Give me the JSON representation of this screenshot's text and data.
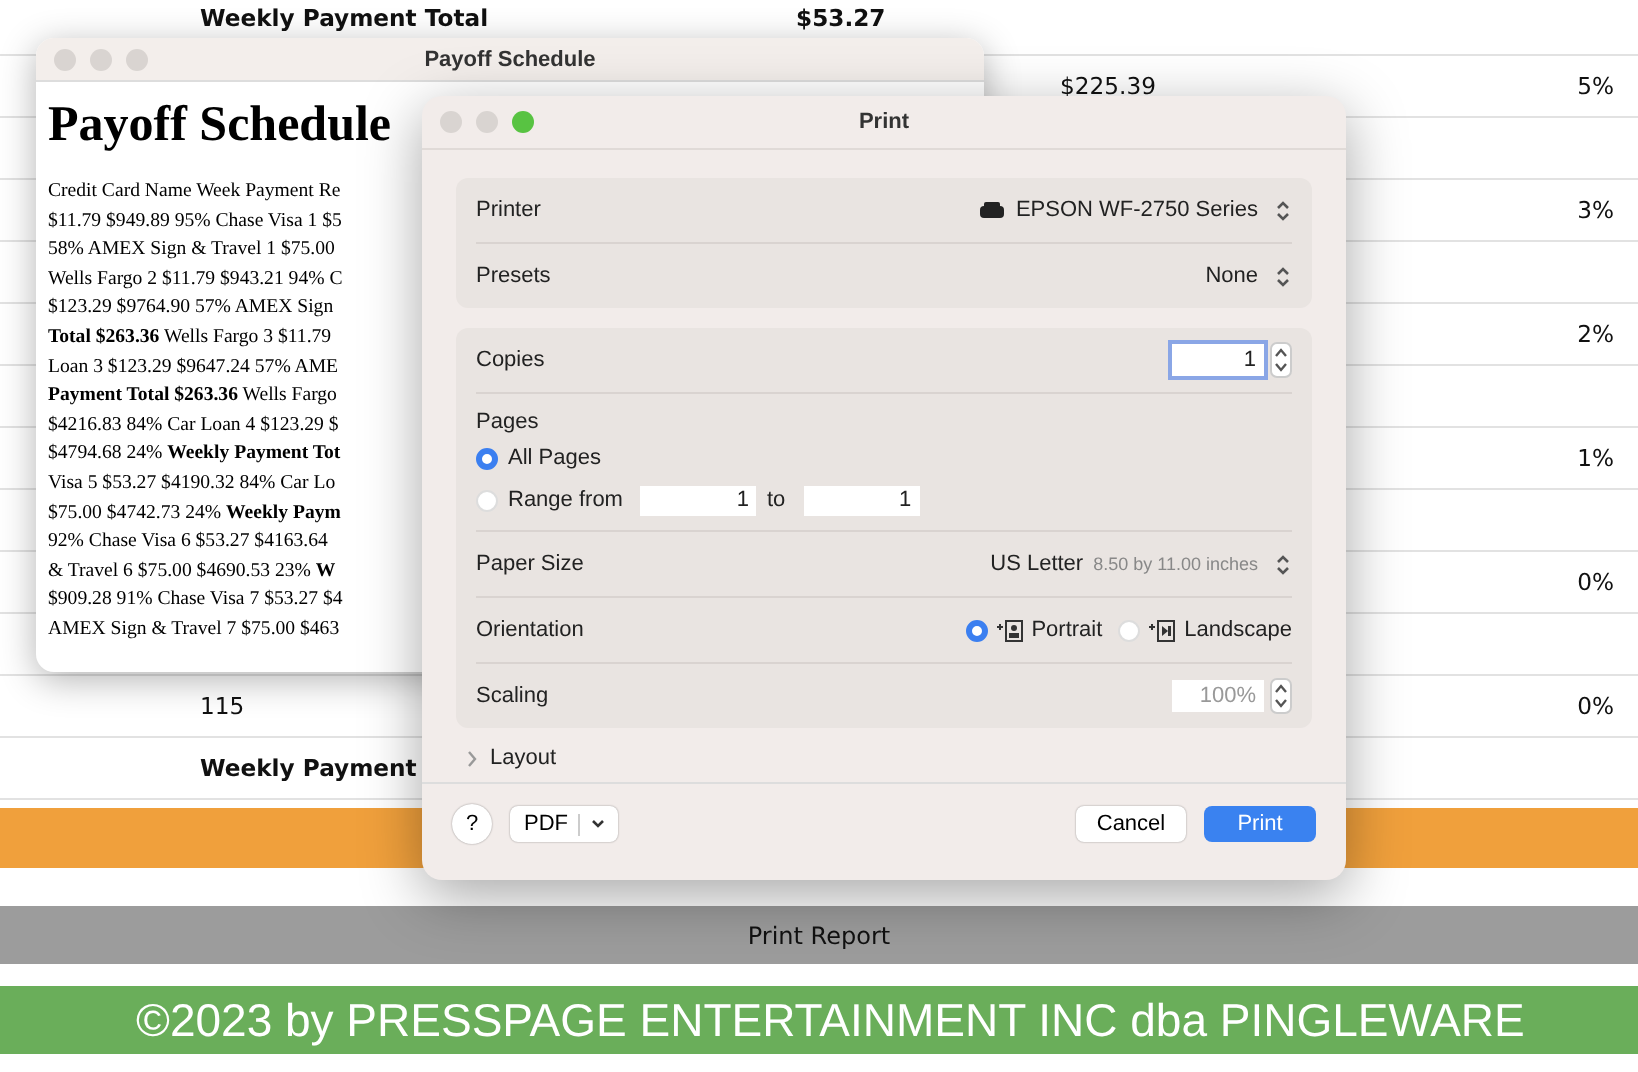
{
  "report": {
    "rows": [
      {
        "kind": "total",
        "col_1": "Weekly Payment Total",
        "col_2": "$53.27"
      },
      {
        "kind": "data",
        "col_3": "$225.39",
        "col_4": "5%"
      },
      {
        "kind": "blank"
      },
      {
        "kind": "data",
        "col_4": "3%"
      },
      {
        "kind": "blank"
      },
      {
        "kind": "data",
        "col_4": "2%"
      },
      {
        "kind": "blank"
      },
      {
        "kind": "data",
        "col_4": "1%"
      },
      {
        "kind": "blank"
      },
      {
        "kind": "data",
        "col_4": "0%"
      },
      {
        "kind": "blank"
      },
      {
        "kind": "data",
        "col_1": "115",
        "col_4": "0%"
      },
      {
        "kind": "total",
        "col_1": "Weekly Payment"
      }
    ],
    "print_button": "Print Report",
    "footer": "©2023 by PRESSPAGE ENTERTAINMENT INC dba PINGLEWARE"
  },
  "payoff_window": {
    "title": "Payoff Schedule",
    "heading": "Payoff Schedule",
    "lines": [
      "Credit Card Name Week Payment Re",
      "$11.79 $949.89 95% Chase Visa 1 $5",
      "58% AMEX Sign & Travel 1 $75.00",
      "Wells Fargo 2 $11.79 $943.21 94% C",
      "$123.29 $9764.90 57% AMEX Sign",
      "**Total $263.36** Wells Fargo 3 $11.79",
      "Loan 3 $123.29 $9647.24 57% AME",
      "**Payment Total $263.36** Wells Fargo",
      "$4216.83 84% Car Loan 4 $123.29 $",
      "$4794.68 24% **Weekly Payment Tot**",
      "Visa 5 $53.27 $4190.32 84% Car Lo",
      "$75.00 $4742.73 24% **Weekly Paym**",
      "92% Chase Visa 6 $53.27 $4163.64",
      "& Travel 6 $75.00 $4690.53 23% **W**",
      "$909.28 91% Chase Visa 7 $53.27 $4",
      "AMEX Sign & Travel 7 $75.00 $463"
    ]
  },
  "print_dialog": {
    "title": "Print",
    "printer": {
      "label": "Printer",
      "value": "EPSON WF-2750 Series"
    },
    "presets": {
      "label": "Presets",
      "value": "None"
    },
    "copies": {
      "label": "Copies",
      "value": "1"
    },
    "pages": {
      "label": "Pages",
      "options": [
        {
          "kind": "all",
          "label": "All Pages",
          "selected": true
        },
        {
          "kind": "range",
          "label": "Range from",
          "selected": false,
          "from": "1",
          "to_label": "to",
          "to": "1"
        }
      ]
    },
    "paper_size": {
      "label": "Paper Size",
      "value": "US Letter",
      "detail": "8.50 by 11.00 inches"
    },
    "orientation": {
      "label": "Orientation",
      "options": [
        {
          "kind": "portrait",
          "label": "Portrait",
          "selected": true
        },
        {
          "kind": "landscape",
          "label": "Landscape",
          "selected": false
        }
      ]
    },
    "scaling": {
      "label": "Scaling",
      "placeholder": "100%"
    },
    "layout": {
      "label": "Layout",
      "expanded": false
    },
    "help": "?",
    "pdf": "PDF",
    "cancel": "Cancel",
    "print": "Print"
  }
}
